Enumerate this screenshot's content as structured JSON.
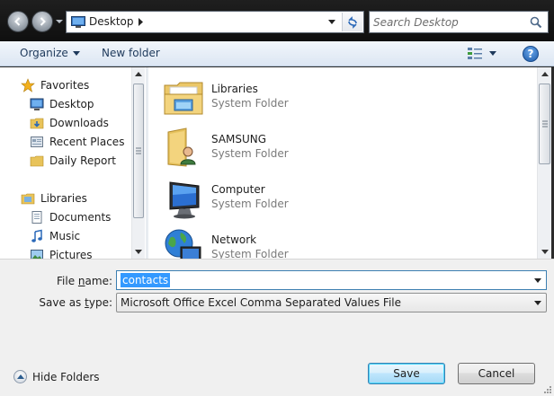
{
  "address_bar": {
    "location": "Desktop",
    "search_placeholder": "Search Desktop"
  },
  "toolbar": {
    "organize_label": "Organize",
    "new_folder_label": "New folder",
    "help_label": "?"
  },
  "nav_pane": {
    "groups": [
      {
        "label": "Favorites",
        "icon": "star-icon",
        "items": [
          {
            "label": "Desktop",
            "icon": "desktop-icon"
          },
          {
            "label": "Downloads",
            "icon": "downloads-folder-icon"
          },
          {
            "label": "Recent Places",
            "icon": "recent-places-icon"
          },
          {
            "label": "Daily Report",
            "icon": "folder-icon"
          }
        ]
      },
      {
        "label": "Libraries",
        "icon": "libraries-icon",
        "items": [
          {
            "label": "Documents",
            "icon": "documents-icon"
          },
          {
            "label": "Music",
            "icon": "music-icon"
          },
          {
            "label": "Pictures",
            "icon": "pictures-icon"
          }
        ]
      }
    ]
  },
  "content": {
    "items": [
      {
        "name": "Libraries",
        "type": "System Folder",
        "icon": "libraries-folder-icon"
      },
      {
        "name": "SAMSUNG",
        "type": "System Folder",
        "icon": "user-folder-icon"
      },
      {
        "name": "Computer",
        "type": "System Folder",
        "icon": "computer-icon"
      },
      {
        "name": "Network",
        "type": "System Folder",
        "icon": "network-icon"
      }
    ]
  },
  "bottom": {
    "file_name_label_pre": "File ",
    "file_name_label_u": "n",
    "file_name_label_post": "ame:",
    "file_name_value": "contacts",
    "save_as_label_pre": "Save as ",
    "save_as_label_u": "t",
    "save_as_label_post": "ype:",
    "save_as_value": "Microsoft Office Excel Comma Separated Values File",
    "hide_folders_label": "Hide Folders",
    "save_button": "Save",
    "cancel_button": "Cancel"
  },
  "colors": {
    "selection": "#3399ff",
    "toolbar_text": "#1e395b",
    "dark_frame": "#1a1a1a"
  }
}
